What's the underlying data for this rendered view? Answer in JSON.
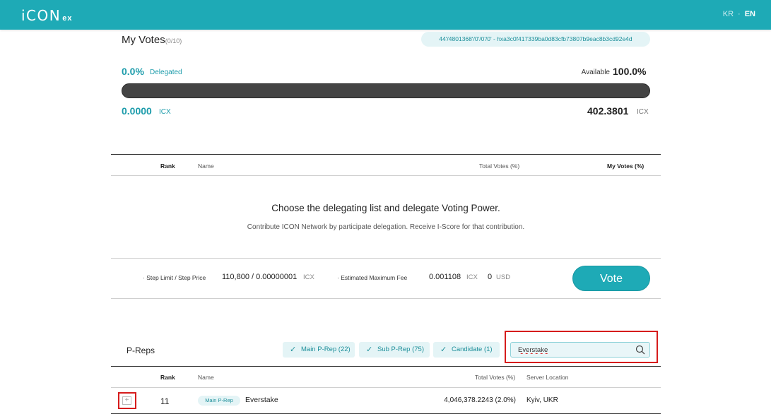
{
  "header": {
    "logo_main": "iCON",
    "logo_sub": "ex",
    "lang_kr": "KR",
    "lang_sep": "·",
    "lang_en": "EN"
  },
  "my_votes": {
    "title": "My Votes",
    "count": "(0/10)",
    "address": "44'/4801368'/0'/0'/0' - hxa3c0f417339ba0d83cfb73807b9eac8b3cd92e4d",
    "delegated_pct": "0.0%",
    "delegated_label": "Delegated",
    "available_label": "Available",
    "available_pct": "100.0%",
    "delegated_fraction": 0,
    "delegated_icx": "0.0000",
    "delegated_unit": "ICX",
    "available_icx": "402.3801",
    "available_unit": "ICX"
  },
  "votes_table": {
    "col_rank": "Rank",
    "col_name": "Name",
    "col_total": "Total Votes (%)",
    "col_my": "My Votes (%)",
    "empty_title": "Choose the delegating list and delegate Voting Power.",
    "empty_sub": "Contribute ICON Network by participate delegation. Receive I-Score for that contribution."
  },
  "fees": {
    "step_label": "· Step Limit / Step Price",
    "step_value": "110,800 / 0.00000001",
    "step_unit": "ICX",
    "est_label": "· Estimated Maximum Fee",
    "est_value": "0.001108",
    "est_unit": "ICX",
    "usd_value": "0",
    "usd_unit": "USD",
    "vote_button": "Vote"
  },
  "preps": {
    "title": "P-Reps",
    "filters": [
      {
        "label": "Main P-Rep (22)"
      },
      {
        "label": "Sub P-Rep (75)"
      },
      {
        "label": "Candidate (1)"
      }
    ],
    "search_value": "Everstake",
    "col_rank": "Rank",
    "col_name": "Name",
    "col_total": "Total Votes (%)",
    "col_location": "Server Location",
    "rows": [
      {
        "add": "+",
        "rank": "11",
        "badge": "Main P-Rep",
        "name": "Everstake",
        "total_votes": "4,046,378.2243 (2.0%)",
        "location": "Kyiv, UKR"
      }
    ]
  },
  "colors": {
    "brand": "#1eaab6",
    "highlight": "#d61c1c"
  }
}
